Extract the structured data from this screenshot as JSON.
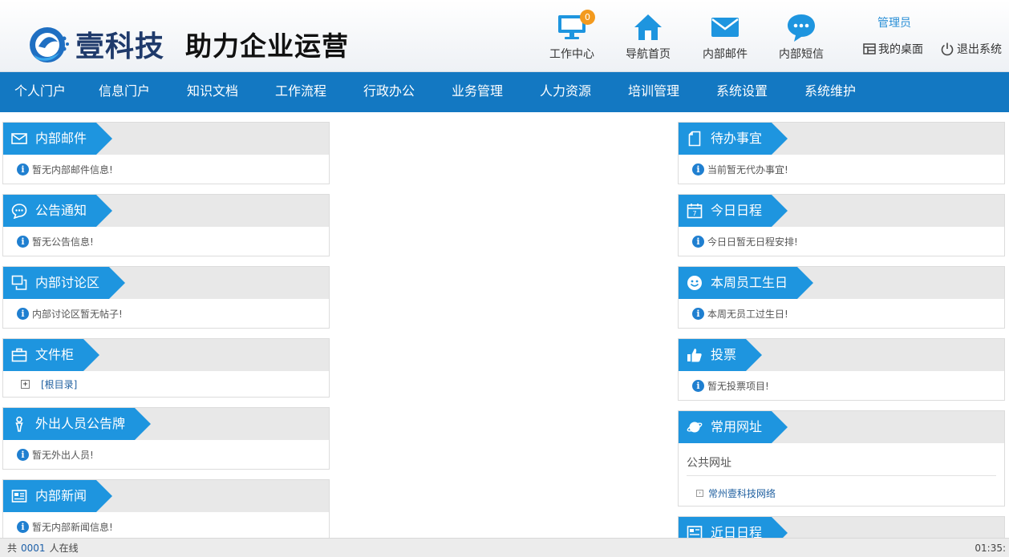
{
  "header": {
    "brand": "壹科技",
    "slogan": "助力企业运营",
    "nav": [
      {
        "label": "工作中心",
        "icon": "monitor-icon",
        "badge": "0"
      },
      {
        "label": "导航首页",
        "icon": "home-icon"
      },
      {
        "label": "内部邮件",
        "icon": "mail-icon"
      },
      {
        "label": "内部短信",
        "icon": "chat-icon"
      }
    ],
    "user": "管理员",
    "desktop_label": "我的桌面",
    "logout_label": "退出系统"
  },
  "main_nav": [
    "个人门户",
    "信息门户",
    "知识文档",
    "工作流程",
    "行政办公",
    "业务管理",
    "人力资源",
    "培训管理",
    "系统设置",
    "系统维护"
  ],
  "left_panels": [
    {
      "title": "内部邮件",
      "icon": "mail-icon",
      "message": "暂无内部邮件信息!"
    },
    {
      "title": "公告通知",
      "icon": "chat-bubble-icon",
      "message": "暂无公告信息!"
    },
    {
      "title": "内部讨论区",
      "icon": "discussion-icon",
      "message": "内部讨论区暂无帖子!"
    },
    {
      "title": "文件柜",
      "icon": "briefcase-icon",
      "tree_item": "[根目录]"
    },
    {
      "title": "外出人员公告牌",
      "icon": "person-icon",
      "message": "暂无外出人员!"
    },
    {
      "title": "内部新闻",
      "icon": "newspaper-icon",
      "message": "暂无内部新闻信息!"
    }
  ],
  "right_panels": [
    {
      "title": "待办事宜",
      "icon": "document-icon",
      "message": "当前暂无代办事宜!"
    },
    {
      "title": "今日日程",
      "icon": "calendar-icon",
      "message": "今日日暂无日程安排!"
    },
    {
      "title": "本周员工生日",
      "icon": "smile-icon",
      "message": "本周无员工过生日!"
    },
    {
      "title": "投票",
      "icon": "thumbs-up-icon",
      "message": "暂无投票项目!"
    },
    {
      "title": "常用网址",
      "icon": "planet-icon",
      "subheading": "公共网址",
      "link": "常州壹科技网络"
    },
    {
      "title": "近日日程",
      "icon": "calendar-list-icon"
    }
  ],
  "footer": {
    "prefix": "共",
    "online_count": "0001",
    "suffix": "人在线",
    "time": "01:35:"
  },
  "colors": {
    "nav_bar": "#1378c2",
    "tab": "#1e95df",
    "badge": "#f39a1e"
  }
}
